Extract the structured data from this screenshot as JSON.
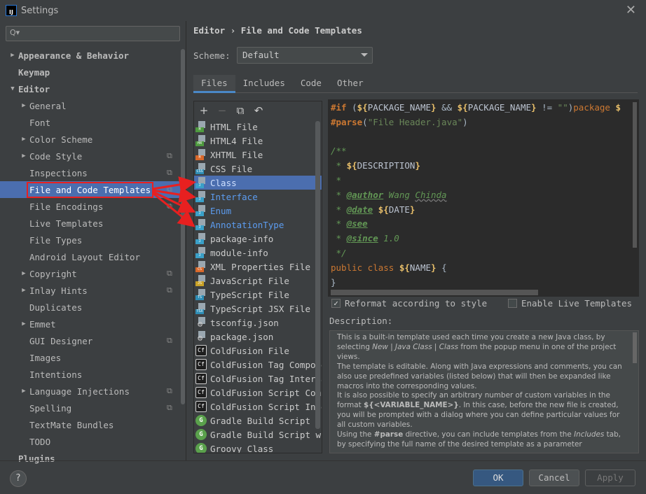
{
  "window": {
    "title": "Settings",
    "logo": "IJ"
  },
  "search": {
    "placeholder": "Q▾"
  },
  "tree": [
    {
      "label": "Appearance & Behavior",
      "level": 0,
      "arrow": "▶"
    },
    {
      "label": "Keymap",
      "level": 0
    },
    {
      "label": "Editor",
      "level": 0,
      "arrow": "▼"
    },
    {
      "label": "General",
      "level": 1,
      "arrow": "▶"
    },
    {
      "label": "Font",
      "level": 1
    },
    {
      "label": "Color Scheme",
      "level": 1,
      "arrow": "▶"
    },
    {
      "label": "Code Style",
      "level": 1,
      "arrow": "▶",
      "cfg": true
    },
    {
      "label": "Inspections",
      "level": 1,
      "cfg": true
    },
    {
      "label": "File and Code Templates",
      "level": 1,
      "cfg": true,
      "selected": true
    },
    {
      "label": "File Encodings",
      "level": 1,
      "cfg": true
    },
    {
      "label": "Live Templates",
      "level": 1
    },
    {
      "label": "File Types",
      "level": 1
    },
    {
      "label": "Android Layout Editor",
      "level": 1
    },
    {
      "label": "Copyright",
      "level": 1,
      "arrow": "▶",
      "cfg": true
    },
    {
      "label": "Inlay Hints",
      "level": 1,
      "arrow": "▶",
      "cfg": true
    },
    {
      "label": "Duplicates",
      "level": 1
    },
    {
      "label": "Emmet",
      "level": 1,
      "arrow": "▶"
    },
    {
      "label": "GUI Designer",
      "level": 1,
      "cfg": true
    },
    {
      "label": "Images",
      "level": 1
    },
    {
      "label": "Intentions",
      "level": 1
    },
    {
      "label": "Language Injections",
      "level": 1,
      "arrow": "▶",
      "cfg": true
    },
    {
      "label": "Spelling",
      "level": 1,
      "cfg": true
    },
    {
      "label": "TextMate Bundles",
      "level": 1
    },
    {
      "label": "TODO",
      "level": 1
    },
    {
      "label": "Plugins",
      "level": 0
    }
  ],
  "breadcrumb": {
    "part1": "Editor",
    "sep": "›",
    "part2": "File and Code Templates"
  },
  "scheme": {
    "label": "Scheme:",
    "value": "Default"
  },
  "tabs": [
    "Files",
    "Includes",
    "Code",
    "Other"
  ],
  "active_tab": "Files",
  "list_toolbar": {
    "add": "+",
    "remove": "−",
    "copy": "⧉",
    "reset": "↶"
  },
  "templates": [
    {
      "name": "HTML File",
      "icon": "html",
      "badge": "H",
      "color": "#4e9a3f"
    },
    {
      "name": "HTML4 File",
      "icon": "html",
      "badge": "H4",
      "color": "#4e9a3f"
    },
    {
      "name": "XHTML File",
      "icon": "html",
      "badge": "H",
      "color": "#d8682a"
    },
    {
      "name": "CSS File",
      "icon": "css",
      "badge": "CSS",
      "color": "#2e8db5"
    },
    {
      "name": "Class",
      "icon": "java",
      "badge": "J",
      "color": "#3aa0c8",
      "selected": true,
      "blue": true
    },
    {
      "name": "Interface",
      "icon": "java",
      "badge": "J",
      "color": "#3aa0c8",
      "blue": true
    },
    {
      "name": "Enum",
      "icon": "java",
      "badge": "J",
      "color": "#3aa0c8",
      "blue": true
    },
    {
      "name": "AnnotationType",
      "icon": "java",
      "badge": "J",
      "color": "#3aa0c8",
      "blue": true
    },
    {
      "name": "package-info",
      "icon": "java",
      "badge": "J",
      "color": "#3aa0c8"
    },
    {
      "name": "module-info",
      "icon": "java",
      "badge": "J",
      "color": "#3aa0c8"
    },
    {
      "name": "XML Properties File",
      "icon": "xml",
      "badge": "CS",
      "color": "#d8682a"
    },
    {
      "name": "JavaScript File",
      "icon": "js",
      "badge": "JS",
      "color": "#c9a227"
    },
    {
      "name": "TypeScript File",
      "icon": "ts",
      "badge": "TS",
      "color": "#2e8db5"
    },
    {
      "name": "TypeScript JSX File",
      "icon": "tsx",
      "badge": "TSX",
      "color": "#2e8db5"
    },
    {
      "name": "tsconfig.json",
      "icon": "json-gear",
      "badge": "",
      "color": "#888"
    },
    {
      "name": "package.json",
      "icon": "json-gear",
      "badge": "",
      "color": "#888"
    },
    {
      "name": "ColdFusion File",
      "icon": "coldfusion",
      "badge": "Cf",
      "color": "#1e1e1e"
    },
    {
      "name": "ColdFusion Tag Component",
      "icon": "coldfusion",
      "badge": "Cf",
      "color": "#1e1e1e"
    },
    {
      "name": "ColdFusion Tag Interface",
      "icon": "coldfusion",
      "badge": "Cf",
      "color": "#1e1e1e"
    },
    {
      "name": "ColdFusion Script Component",
      "icon": "coldfusion",
      "badge": "Cf",
      "color": "#1e1e1e"
    },
    {
      "name": "ColdFusion Script Interface",
      "icon": "coldfusion",
      "badge": "Cf",
      "color": "#1e1e1e"
    },
    {
      "name": "Gradle Build Script",
      "icon": "gradle",
      "badge": "G",
      "color": "#5aa14c"
    },
    {
      "name": "Gradle Build Script with wrapper",
      "icon": "gradle",
      "badge": "G",
      "color": "#5aa14c"
    },
    {
      "name": "Groovy Class",
      "icon": "groovy",
      "badge": "G",
      "color": "#5aa14c"
    }
  ],
  "code": {
    "line1": {
      "a": "#if",
      "b": " (",
      "c": "${",
      "d": "PACKAGE_NAME",
      "e": "}",
      "f": " && ",
      "g": "${",
      "h": "PACKAGE_NAME",
      "i": "}",
      "j": " != ",
      "k": "\"\"",
      "l": ")",
      "m": "package ",
      "n": "$"
    },
    "line2": {
      "a": "#parse",
      "b": "(",
      "c": "\"File Header.java\"",
      "d": ")"
    },
    "line4": "/**",
    "line5": {
      "a": " * ",
      "b": "${",
      "c": "DESCRIPTION",
      "d": "}"
    },
    "line6": " *",
    "line7": {
      "a": " * ",
      "b": "@author",
      "c": " Wang ",
      "d": "Chinda"
    },
    "line8": {
      "a": " * ",
      "b": "@date",
      "c": " ",
      "d": "${",
      "e": "DATE",
      "f": "}"
    },
    "line9": {
      "a": " * ",
      "b": "@see"
    },
    "line10": {
      "a": " * ",
      "b": "@since",
      "c": " 1.0"
    },
    "line11": " */",
    "line12": {
      "a": "public class ",
      "b": "${",
      "c": "NAME",
      "d": "}",
      "e": " {"
    },
    "line13": "}"
  },
  "options": {
    "reformat": "Reformat according to style",
    "reformat_checked": true,
    "live": "Enable Live Templates",
    "live_checked": false
  },
  "description": {
    "label": "Description:",
    "p1a": "This is a built-in template used each time you create a new Java class, by selecting ",
    "p1b": "New | Java Class | Class",
    "p1c": " from the popup menu in one of the project views.",
    "p2": "The template is editable. Along with Java expressions and comments, you can also use predefined variables (listed below) that will then be expanded like macros into the corresponding values.",
    "p3a": "It is also possible to specify an arbitrary number of custom variables in the format ",
    "p3b": "${<VARIABLE_NAME>}",
    "p3c": ". In this case, before the new file is created, you will be prompted with a dialog where you can define particular values for all custom variables.",
    "p4a": "Using the ",
    "p4b": "#parse",
    "p4c": " directive, you can include templates from the ",
    "p4d": "Includes",
    "p4e": " tab, by specifying the full name of the desired template as a parameter"
  },
  "footer": {
    "help": "?",
    "ok": "OK",
    "cancel": "Cancel",
    "apply": "Apply"
  },
  "colors": {
    "accent": "#4b6eaf",
    "annotation": "#e82020",
    "ok": "#365880"
  }
}
